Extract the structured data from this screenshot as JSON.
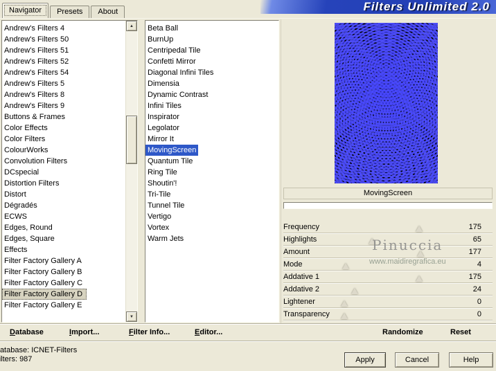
{
  "title": "Filters Unlimited 2.0",
  "tabs": {
    "items": [
      {
        "label": "Navigator"
      },
      {
        "label": "Presets"
      },
      {
        "label": "About"
      }
    ],
    "active": "Navigator"
  },
  "categories": {
    "items": [
      "Andrew's Filters 4",
      "Andrew's Filters 50",
      "Andrew's Filters 51",
      "Andrew's Filters 52",
      "Andrew's Filters 54",
      "Andrew's Filters 5",
      "Andrew's Filters 8",
      "Andrew's Filters 9",
      "Buttons & Frames",
      "Color Effects",
      "Color Filters",
      "ColourWorks",
      "Convolution Filters",
      "DCspecial",
      "Distortion Filters",
      "Distort",
      "Dégradés",
      "ECWS",
      "Edges, Round",
      "Edges, Square",
      "Effects",
      "Filter Factory Gallery A",
      "Filter Factory Gallery B",
      "Filter Factory Gallery C",
      "Filter Factory Gallery D",
      "Filter Factory Gallery E"
    ],
    "selected": "Filter Factory Gallery D"
  },
  "filters": {
    "items": [
      "Beta Ball",
      "BurnUp",
      "Centripedal Tile",
      "Confetti Mirror",
      "Diagonal Infini Tiles",
      "Dimensia",
      "Dynamic Contrast",
      "Infini Tiles",
      "Inspirator",
      "Legolator",
      "Mirror It",
      "MovingScreen",
      "Quantum Tile",
      "Ring Tile",
      "Shoutin'!",
      "Tri-Tile",
      "Tunnel Tile",
      "Vertigo",
      "Vortex",
      "Warm Jets"
    ],
    "selected": "MovingScreen"
  },
  "preview": {
    "caption": "MovingScreen"
  },
  "sliders": {
    "max": 255,
    "items": [
      {
        "label": "Frequency",
        "value": 175
      },
      {
        "label": "Highlights",
        "value": 65
      },
      {
        "label": "Amount",
        "value": 177
      },
      {
        "label": "Mode",
        "value": 4
      },
      {
        "label": "Addative 1",
        "value": 175
      },
      {
        "label": "Addative 2",
        "value": 24
      },
      {
        "label": "Lightener",
        "value": 0
      },
      {
        "label": "Transparency",
        "value": 0
      }
    ]
  },
  "watermark": {
    "name": "Pinuccia",
    "url": "www.maidiregrafica.eu"
  },
  "menu": {
    "items": [
      {
        "label": "Database"
      },
      {
        "label": "Import..."
      },
      {
        "label": "Filter Info..."
      },
      {
        "label": "Editor..."
      }
    ]
  },
  "actions": {
    "randomize": "Randomize",
    "reset": "Reset"
  },
  "status": {
    "database_label": "Database:",
    "database_value": "ICNET-Filters",
    "filters_label": "Filters:",
    "filters_value": "987"
  },
  "buttons": {
    "apply": "Apply",
    "cancel": "Cancel",
    "help": "Help"
  },
  "icons": {
    "scroll_up": "▲",
    "scroll_down": "▼"
  },
  "colors": {
    "background": "#ece9d8",
    "selection_blue": "#2e58c8",
    "title_bar_blue": "#2340b6",
    "preview_blue": "#2222dd"
  }
}
